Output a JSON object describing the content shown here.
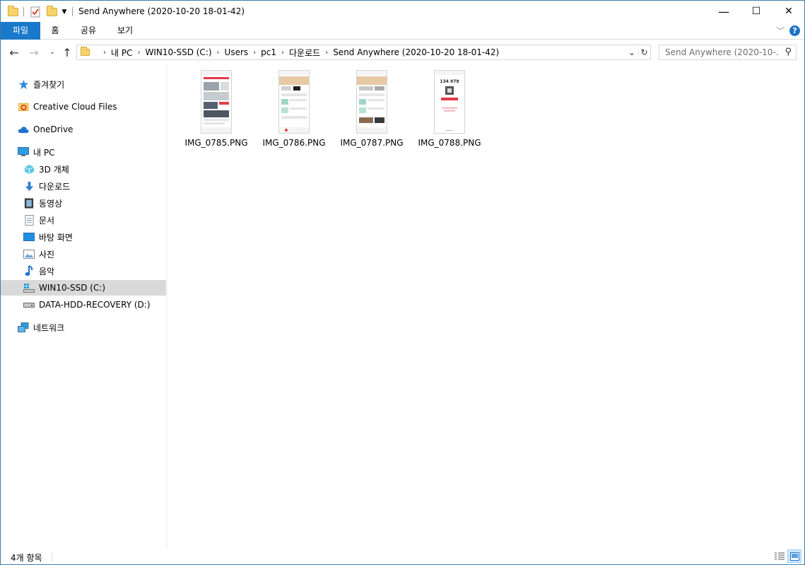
{
  "window": {
    "title": "Send Anywhere (2020-10-20 18-01-42)",
    "minimize": "—",
    "maximize": "☐",
    "close": "✕"
  },
  "ribbon": {
    "tabs": [
      {
        "label": "파일"
      },
      {
        "label": "홈"
      },
      {
        "label": "공유"
      },
      {
        "label": "보기"
      }
    ],
    "help": "?"
  },
  "address": {
    "crumbs": [
      "내 PC",
      "WIN10-SSD (C:)",
      "Users",
      "pc1",
      "다운로드",
      "Send Anywhere (2020-10-20 18-01-42)"
    ],
    "separator": "›"
  },
  "search": {
    "placeholder": "Send Anywhere (2020-10-..."
  },
  "navpane": {
    "quick_access": "즐겨찾기",
    "creative_cloud": "Creative Cloud Files",
    "onedrive": "OneDrive",
    "this_pc": "내 PC",
    "objects_3d": "3D 개체",
    "downloads": "다운로드",
    "videos": "동영상",
    "documents": "문서",
    "desktop": "바탕 화면",
    "pictures": "사진",
    "music": "음악",
    "drive_c": "WIN10-SSD (C:)",
    "drive_d": "DATA-HDD-RECOVERY (D:)",
    "network": "네트워크"
  },
  "files": [
    {
      "name": "IMG_0785.PNG"
    },
    {
      "name": "IMG_0786.PNG"
    },
    {
      "name": "IMG_0787.PNG"
    },
    {
      "name": "IMG_0788.PNG",
      "thumb_text": "134 979"
    }
  ],
  "status": {
    "count": "4개 항목"
  },
  "colors": {
    "accent": "#1979ca",
    "selected_bg": "#d9d9d9",
    "folder": "#f7d36b"
  }
}
